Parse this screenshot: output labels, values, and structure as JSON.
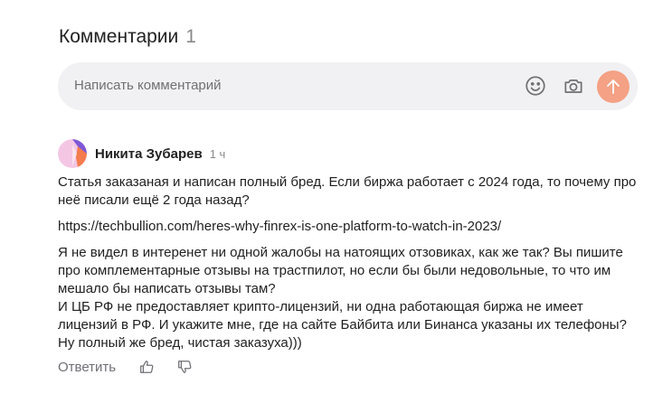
{
  "header": {
    "title": "Комментарии",
    "count": "1"
  },
  "composer": {
    "placeholder": "Написать комментарий",
    "emoji_icon": "smiley-icon",
    "camera_icon": "camera-icon",
    "send_icon": "arrow-up-icon",
    "send_color": "#f4a185"
  },
  "comment": {
    "author": "Никита Зубарев",
    "time": "1 ч",
    "paragraphs": [
      "Статья заказаная и написан полный бред. Если биржа работает с 2024 года, то почему про неё писали ещё 2 года назад?",
      "https://techbullion.com/heres-why-finrex-is-one-platform-to-watch-in-2023/",
      "Я не видел в интеренет ни одной жалобы на натоящих отзовиках, как же так? Вы пишите про комплементарные отзывы на трастпилот, но если бы были недовольные, то что им мешало бы написать отзывы там?",
      "И ЦБ РФ не предоставляет крипто-лицензий, ни одна работающая биржа не имеет лицензий в РФ. И укажите мне, где на сайте Байбита или Бинанса указаны их телефоны? Ну полный же бред, чистая заказуха)))"
    ],
    "reply_label": "Ответить",
    "like_icon": "thumbs-up-icon",
    "dislike_icon": "thumbs-down-icon"
  }
}
